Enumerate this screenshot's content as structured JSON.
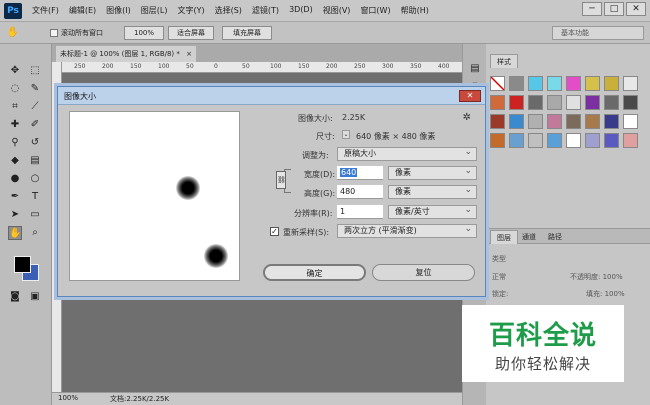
{
  "app": {
    "logo": "Ps"
  },
  "menu": {
    "items": [
      "文件(F)",
      "编辑(E)",
      "图像(I)",
      "图层(L)",
      "文字(Y)",
      "选择(S)",
      "滤镜(T)",
      "3D(D)",
      "视图(V)",
      "窗口(W)",
      "帮助(H)"
    ]
  },
  "window_controls": {
    "minimize": "─",
    "restore": "□",
    "close": "✕"
  },
  "options": {
    "scroll_all_label": "滚动所有窗口",
    "zoom_value": "100%",
    "fit_screen_label": "适合屏幕",
    "fill_screen_label": "填充屏幕",
    "workspace_label": "基本功能"
  },
  "document": {
    "tab_label": "未标题-1 @ 100% (图层 1, RGB/8) *",
    "tab_close": "×",
    "ruler_ticks": [
      "250",
      "200",
      "150",
      "100",
      "50",
      "0",
      "50",
      "100",
      "150",
      "200",
      "250",
      "300",
      "350",
      "400"
    ],
    "status_zoom": "100%",
    "status_doc": "文档:2.25K/2.25K"
  },
  "panels": {
    "styles_tab": "样式",
    "layers_tab": "图层",
    "channels_tab": "通道",
    "paths_tab": "路径",
    "kind_label": "类型",
    "mode_label": "正常",
    "opacity_label": "不透明度: 100%",
    "lock_label": "锁定:",
    "fill_label": "填充: 100%",
    "style_colors": [
      "#ffffff",
      "#8a8a8a",
      "#56c7e6",
      "#7ad9e8",
      "#e44dc8",
      "#d4c04a",
      "#c9b03a",
      "#e8e8e8",
      "#d06a3a",
      "#cc2222",
      "#6a6a6a",
      "#a9a9a9",
      "#e0e0e0",
      "#7b2fa0",
      "#6a6a6a",
      "#4a4a4a",
      "#9a3b2a",
      "#3a8ad0",
      "#b0b0b0",
      "#c27a9a",
      "#7b6b5a",
      "#a67a4a",
      "#3a3a8a",
      "#ffffff",
      "#c26b2a",
      "#6aa0d0",
      "#c0c0c0",
      "#5aa0d8",
      "#ffffff",
      "#a0a0d0",
      "#5a5ac0",
      "#e0a0a0"
    ]
  },
  "watermark": {
    "title": "百科全说",
    "subtitle": "助你轻松解决"
  },
  "dialog": {
    "title": "图像大小",
    "image_size_label": "图像大小:",
    "image_size_value": "2.25K",
    "dimensions_label": "尺寸:",
    "dimensions_value": "640 像素 × 480 像素",
    "fit_to_label": "调整为:",
    "fit_to_value": "原稿大小",
    "width_label": "宽度(D):",
    "width_value": "640",
    "width_unit": "像素",
    "height_label": "高度(G):",
    "height_value": "480",
    "height_unit": "像素",
    "resolution_label": "分辨率(R):",
    "resolution_value": "1",
    "resolution_unit": "像素/英寸",
    "resample_label": "重新采样(S):",
    "resample_checked": true,
    "resample_value": "两次立方 (平滑渐变)",
    "ok_label": "确定",
    "reset_label": "复位"
  }
}
